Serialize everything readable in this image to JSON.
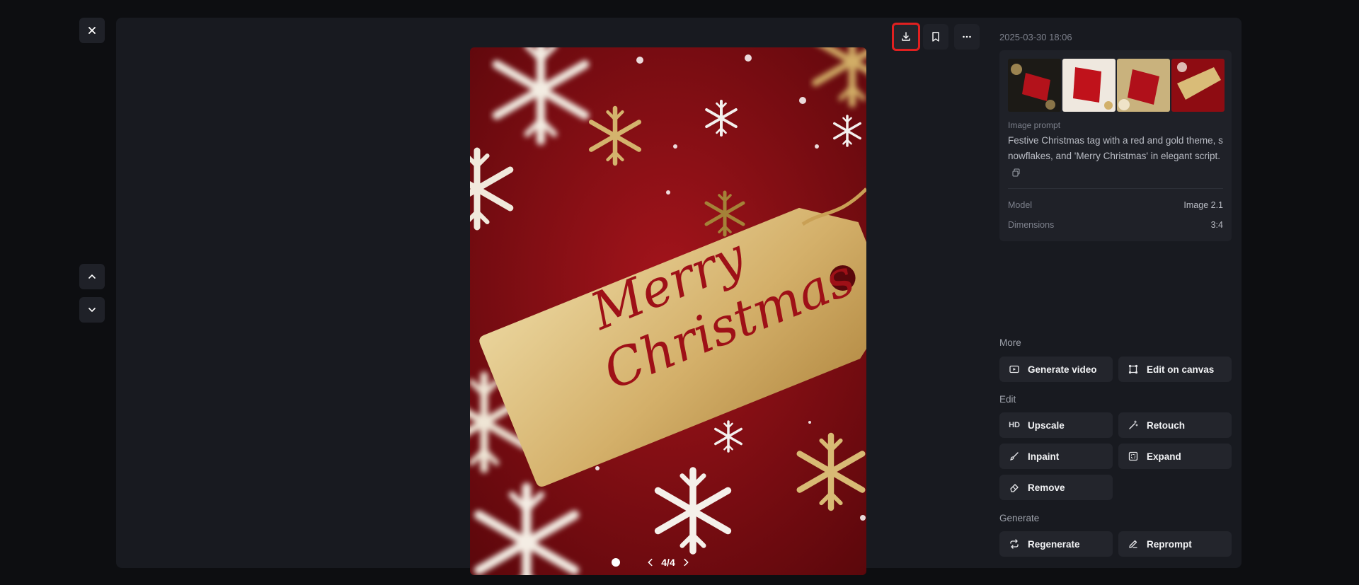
{
  "toolbar": {
    "close_icon": "close-icon",
    "prev_icon": "chevron-up-icon",
    "next_icon": "chevron-down-icon",
    "download_icon": "download-icon",
    "bookmark_icon": "bookmark-icon",
    "more_icon": "more-icon",
    "highlight_color": "#e02020"
  },
  "viewer": {
    "image_subject": "Merry Christmas gold gift tag on red background with snowflakes",
    "tag_text_line1": "Merry",
    "tag_text_line2": "Christmas",
    "pager_text": "4/4"
  },
  "details": {
    "timestamp": "2025-03-30 18:06",
    "prompt_label": "Image prompt",
    "prompt_text": "Festive Christmas tag with a red and gold theme, snowflakes, and 'Merry Christmas' in elegant script.",
    "model_label": "Model",
    "model_value": "Image 2.1",
    "dimensions_label": "Dimensions",
    "dimensions_value": "3:4"
  },
  "sections": {
    "more": "More",
    "edit": "Edit",
    "generate": "Generate"
  },
  "actions": {
    "generate_video": "Generate video",
    "edit_on_canvas": "Edit on canvas",
    "hd_badge": "HD",
    "upscale": "Upscale",
    "retouch": "Retouch",
    "inpaint": "Inpaint",
    "expand": "Expand",
    "remove": "Remove",
    "regenerate": "Regenerate",
    "reprompt": "Reprompt"
  },
  "colors": {
    "background": "#0d0e11",
    "panel": "#181a20",
    "card": "#1f2128",
    "image_red": "#8e0c12",
    "image_gold": "#d9bc78"
  }
}
